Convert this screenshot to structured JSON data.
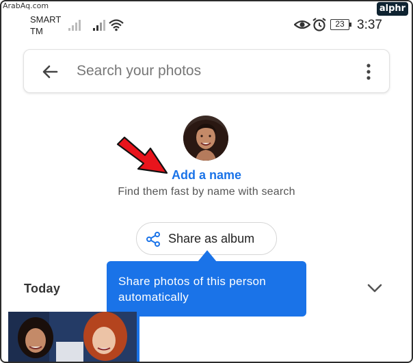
{
  "watermark": {
    "site": "ArabAq.com",
    "brand": "alphr"
  },
  "status_bar": {
    "carrier_line1": "SMART",
    "carrier_line2": "TM",
    "battery": "23",
    "time": "3:37",
    "icons": [
      "signal-icon",
      "signal-icon",
      "wifi-icon",
      "eye-icon",
      "alarm-icon",
      "battery-icon"
    ]
  },
  "search": {
    "placeholder": "Search your photos",
    "back_icon": "arrow-left-icon",
    "more_icon": "more-vert-icon"
  },
  "person": {
    "add_name_label": "Add a name",
    "subtitle": "Find them fast by name with search"
  },
  "share_button": {
    "label": "Share as album",
    "icon": "share-icon"
  },
  "tooltip": {
    "text": "Share photos of this person automatically"
  },
  "section": {
    "title": "Today",
    "toggle_icon": "chevron-down-icon"
  },
  "colors": {
    "accent": "#1a73e8",
    "annotation_arrow": "#e8141c",
    "text_primary": "#222222",
    "text_secondary": "#555555"
  }
}
